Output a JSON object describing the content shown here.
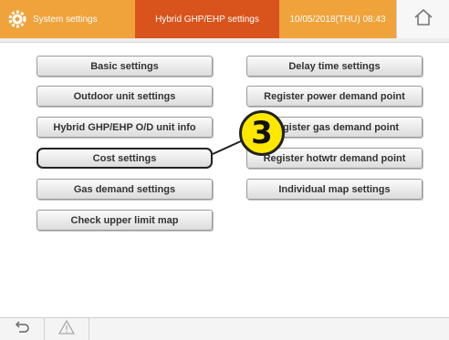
{
  "header": {
    "app_title": "System settings",
    "screen_title": "Hybrid GHP/EHP settings",
    "datetime": "10/05/2018(THU) 08:43",
    "app_icon": "gear-icon",
    "home_icon": "home-icon"
  },
  "buttons": {
    "basic": "Basic settings",
    "outdoor_unit": "Outdoor unit settings",
    "hybrid_od_info": "Hybrid GHP/EHP O/D unit info",
    "cost": "Cost settings",
    "gas_demand": "Gas demand settings",
    "check_upper_limit": "Check upper limit map",
    "delay_time": "Delay time settings",
    "register_power": "Register power demand point",
    "register_gas": "Register gas demand point",
    "register_hotwtr": "Register hotwtr demand point",
    "individual_map": "Individual map settings"
  },
  "annotation": {
    "step_number": "3"
  },
  "footer": {
    "back_icon": "back-arrow-icon",
    "warning_icon": "warning-icon"
  },
  "colors": {
    "header_orange": "#f0a23b",
    "header_active": "#d9531c",
    "badge_yellow": "#ffe800"
  }
}
